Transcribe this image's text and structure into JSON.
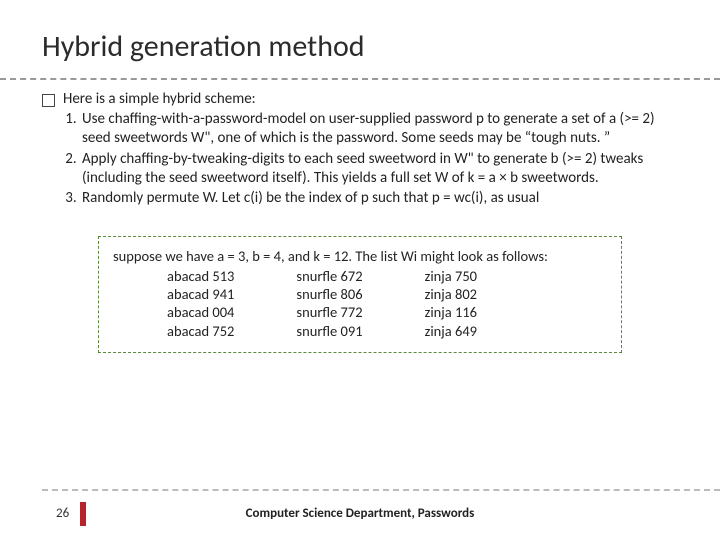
{
  "title": "Hybrid generation method",
  "intro": "Here is a simple hybrid scheme:",
  "steps": [
    "Use chaffing-with-a-password-model on user-supplied password p to generate a set of a (>= 2) seed sweetwords W\", one of which is the password. Some seeds may be “tough nuts. ”",
    "Apply chaffing-by-tweaking-digits to each seed sweetword in W\" to generate b (>= 2) tweaks (including the seed sweetword itself). This yields a full set W of k = a × b sweetwords.",
    "Randomly permute W. Let c(i) be the index of p such that p = wc(i), as usual"
  ],
  "example": {
    "lead": "suppose we have a = 3, b = 4, and k = 12. The list Wi might look as follows:",
    "col1": [
      "abacad 513",
      "abacad 941",
      "abacad 004",
      "abacad 752"
    ],
    "col2": [
      "snurfle 672",
      "snurfle 806",
      "snurfle 772",
      "snurfle 091"
    ],
    "col3": [
      "zinja 750",
      "zinja 802",
      "zinja 116",
      "zinja 649"
    ]
  },
  "footer": {
    "page": "26",
    "text": "Computer Science Department, Passwords"
  }
}
